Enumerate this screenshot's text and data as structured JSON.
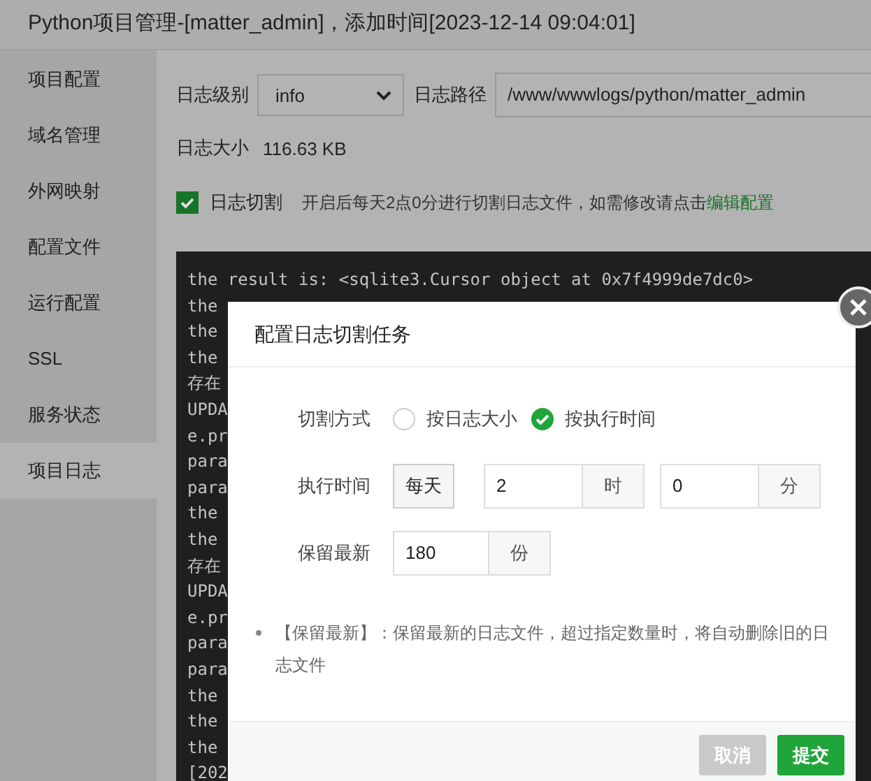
{
  "window": {
    "title": "Python项目管理-[matter_admin]，添加时间[2023-12-14 09:04:01]"
  },
  "sidebar": {
    "items": [
      {
        "label": "项目配置",
        "selected": false
      },
      {
        "label": "域名管理",
        "selected": false
      },
      {
        "label": "外网映射",
        "selected": false
      },
      {
        "label": "配置文件",
        "selected": false
      },
      {
        "label": "运行配置",
        "selected": false
      },
      {
        "label": "SSL",
        "selected": false
      },
      {
        "label": "服务状态",
        "selected": false
      },
      {
        "label": "项目日志",
        "selected": true
      }
    ]
  },
  "log_settings": {
    "level_label": "日志级别",
    "level": "info",
    "path_label": "日志路径",
    "path": "/www/wwwlogs/python/matter_admin",
    "size_label": "日志大小",
    "size": "116.63 KB",
    "rotate": {
      "label": "日志切割",
      "checked": true,
      "description": "开启后每天2点0分进行切割日志文件，如需修改请点击",
      "link": "编辑配置"
    }
  },
  "log_lines": [
    "the result is: <sqlite3.Cursor object at 0x7f4999de7dc0>",
    "the",
    "the",
    "the",
    "存在",
    "UPDA",
    "e.pr",
    "para",
    "para",
    "the",
    "the",
    "存在",
    "UPDA",
    "e.pr",
    "para",
    "para",
    "the",
    "the",
    "the",
    "[202"
  ],
  "dialog": {
    "title": "配置日志切割任务",
    "mode": {
      "label": "切割方式",
      "options": [
        {
          "label": "按日志大小",
          "selected": false
        },
        {
          "label": "按执行时间",
          "selected": true
        }
      ]
    },
    "time": {
      "label": "执行时间",
      "period": "每天",
      "hour": "2",
      "hour_unit": "时",
      "minute": "0",
      "minute_unit": "分"
    },
    "keep": {
      "label": "保留最新",
      "value": "180",
      "unit": "份"
    },
    "notes": [
      "【保留最新】：保留最新的日志文件，超过指定数量时，将自动删除旧的日志文件"
    ],
    "buttons": [
      {
        "label": "取消",
        "kind": "cancel"
      },
      {
        "label": "提交",
        "kind": "submit"
      }
    ]
  }
}
